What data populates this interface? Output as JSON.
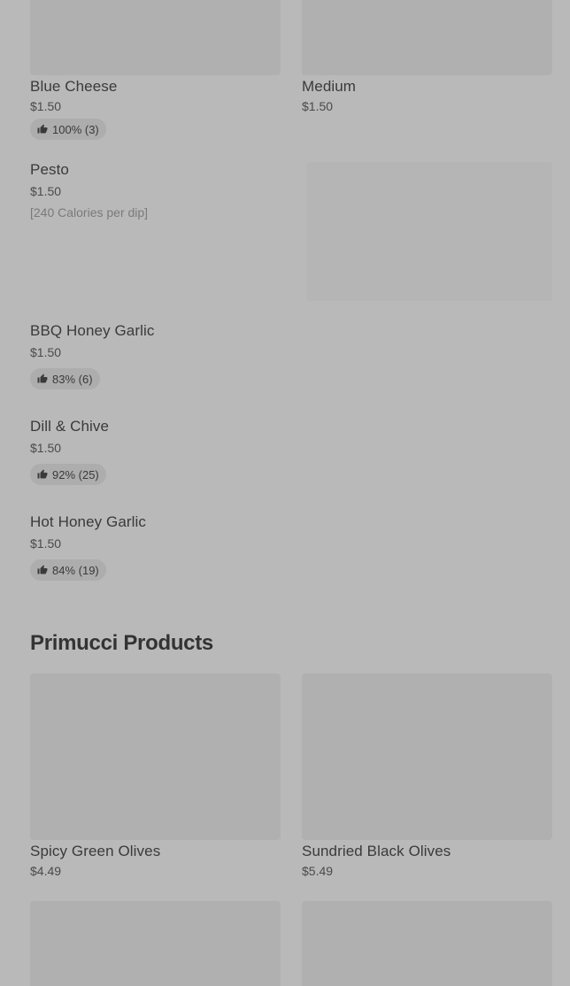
{
  "items": {
    "blue_cheese": {
      "name": "Blue Cheese",
      "price": "$1.50",
      "rating": "100% (3)"
    },
    "medium": {
      "name": "Medium",
      "price": "$1.50"
    },
    "pesto": {
      "name": "Pesto",
      "price": "$1.50",
      "calories": "[240 Calories per dip]"
    },
    "bbq_honey_garlic": {
      "name": "BBQ Honey Garlic",
      "price": "$1.50",
      "rating": "83% (6)"
    },
    "dill_chive": {
      "name": "Dill & Chive",
      "price": "$1.50",
      "rating": "92% (25)"
    },
    "hot_honey_garlic": {
      "name": "Hot Honey Garlic",
      "price": "$1.50",
      "rating": "84% (19)"
    }
  },
  "primucci": {
    "title": "Primucci Products",
    "products": [
      {
        "name": "Spicy Green Olives",
        "price": "$4.49"
      },
      {
        "name": "Sundried Black Olives",
        "price": "$5.49"
      }
    ]
  },
  "icons": {
    "rating": "thumbs-up-icon"
  },
  "colors": {
    "overlay": "#b9b9b9",
    "placeholder": "#b0b0b0"
  }
}
